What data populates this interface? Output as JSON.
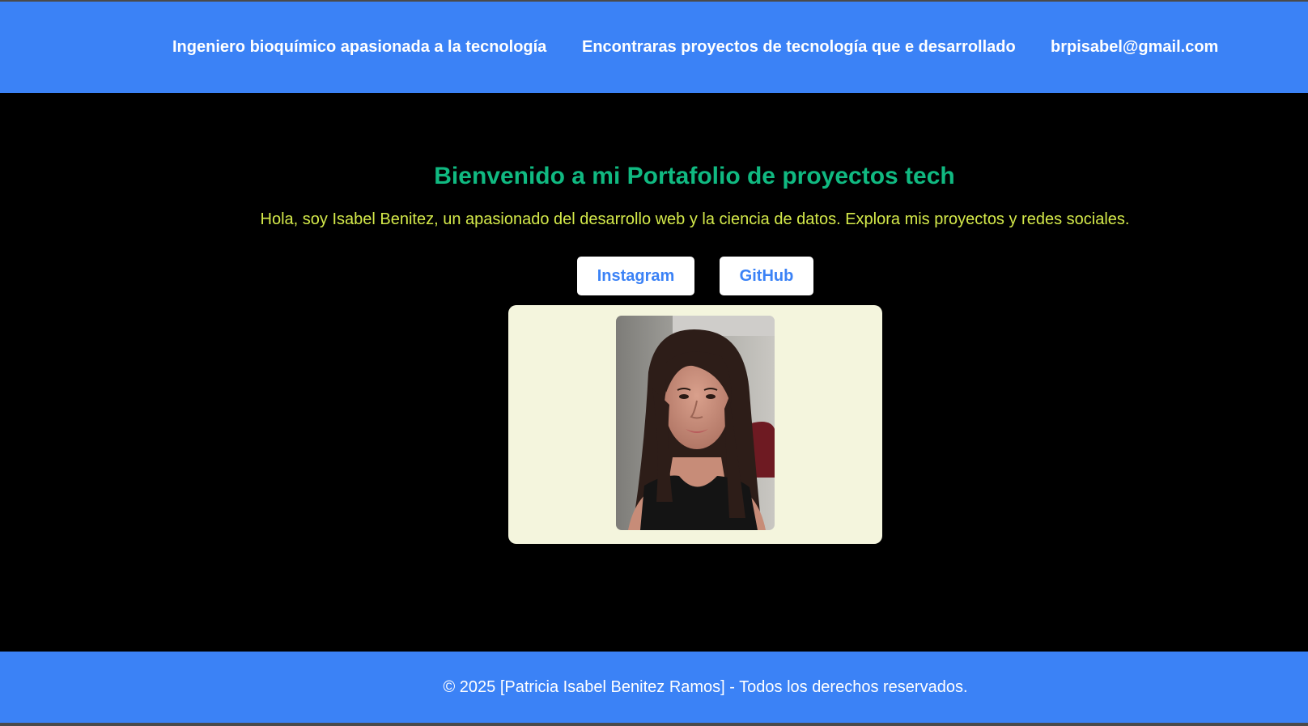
{
  "header": {
    "nav": [
      "Ingeniero bioquímico apasionada a la tecnología",
      "Encontraras proyectos de tecnología que e desarrollado",
      "brpisabel@gmail.com"
    ]
  },
  "hero": {
    "title": "Bienvenido a mi Portafolio de proyectos tech",
    "intro": "Hola, soy Isabel Benitez, un apasionado del desarrollo web y la ciencia de datos. Explora mis proyectos y redes sociales.",
    "buttons": {
      "instagram": "Instagram",
      "github": "GitHub"
    },
    "photo_icon": "profile-photo"
  },
  "footer": {
    "text": "© 2025 [Patricia Isabel Benitez Ramos] - Todos los derechos reservados."
  },
  "colors": {
    "header_bg": "#3b82f6",
    "page_bg": "#000000",
    "title": "#10b981",
    "intro": "#d4e94a",
    "button_text": "#3b82f6",
    "card_bg": "#f4f5dd"
  }
}
